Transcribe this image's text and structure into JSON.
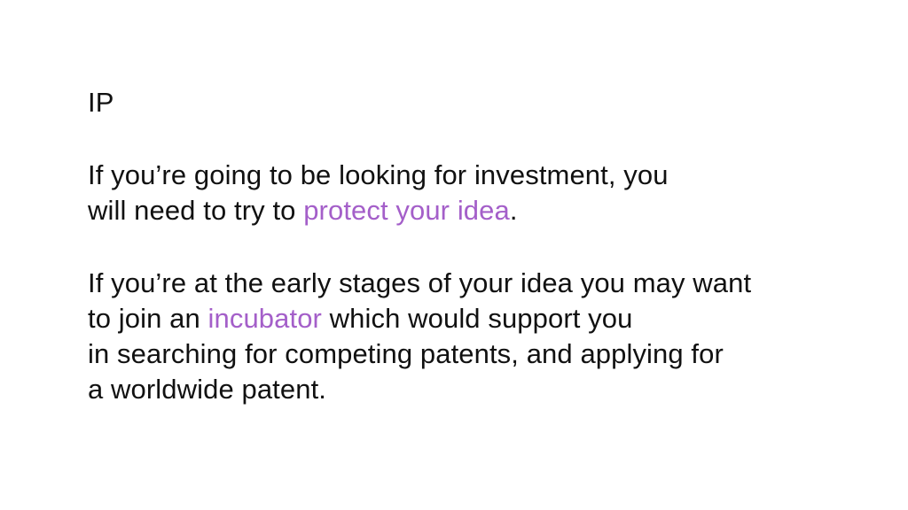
{
  "slide": {
    "heading": "IP",
    "paragraph1": {
      "line1": "If you’re going to be looking for investment, you",
      "line2_before": "will need to try to ",
      "line2_link": "protect your idea",
      "line2_after": "."
    },
    "paragraph2": {
      "line1": "If you’re at the early stages of your idea you may want",
      "line2_before": "to join an ",
      "line2_link": "incubator",
      "line2_after": " which would support you",
      "line3": "in searching for competing patents, and applying for",
      "line4": "a worldwide patent."
    },
    "link_color": "#a45fc9"
  }
}
